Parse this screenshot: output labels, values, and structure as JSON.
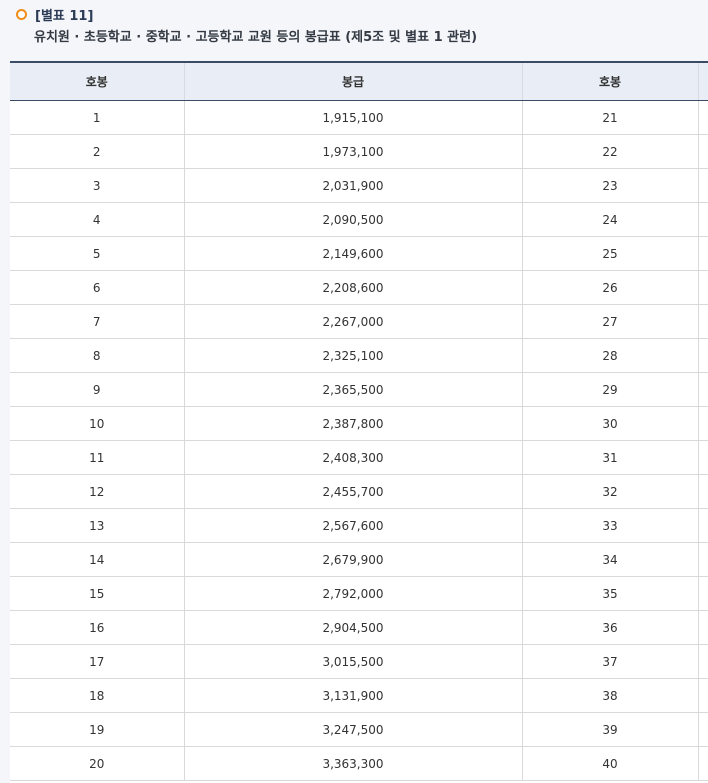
{
  "section": {
    "label": "[별표 11]",
    "subtitle": "유치원 · 초등학교 · 중학교 · 고등학교 교원 등의 봉급표 (제5조 및 별표 1 관련)"
  },
  "table": {
    "headers": [
      "호봉",
      "봉급",
      "호봉",
      ""
    ],
    "rows": [
      [
        "1",
        "1,915,100",
        "21",
        ""
      ],
      [
        "2",
        "1,973,100",
        "22",
        ""
      ],
      [
        "3",
        "2,031,900",
        "23",
        ""
      ],
      [
        "4",
        "2,090,500",
        "24",
        ""
      ],
      [
        "5",
        "2,149,600",
        "25",
        ""
      ],
      [
        "6",
        "2,208,600",
        "26",
        ""
      ],
      [
        "7",
        "2,267,000",
        "27",
        ""
      ],
      [
        "8",
        "2,325,100",
        "28",
        ""
      ],
      [
        "9",
        "2,365,500",
        "29",
        ""
      ],
      [
        "10",
        "2,387,800",
        "30",
        ""
      ],
      [
        "11",
        "2,408,300",
        "31",
        ""
      ],
      [
        "12",
        "2,455,700",
        "32",
        ""
      ],
      [
        "13",
        "2,567,600",
        "33",
        ""
      ],
      [
        "14",
        "2,679,900",
        "34",
        ""
      ],
      [
        "15",
        "2,792,000",
        "35",
        ""
      ],
      [
        "16",
        "2,904,500",
        "36",
        ""
      ],
      [
        "17",
        "3,015,500",
        "37",
        ""
      ],
      [
        "18",
        "3,131,900",
        "38",
        ""
      ],
      [
        "19",
        "3,247,500",
        "39",
        ""
      ],
      [
        "20",
        "3,363,300",
        "40",
        ""
      ]
    ]
  },
  "colors": {
    "bullet": "#f08c1a",
    "header_bg": "#e9eef6",
    "border_dark": "#3b4b66"
  }
}
